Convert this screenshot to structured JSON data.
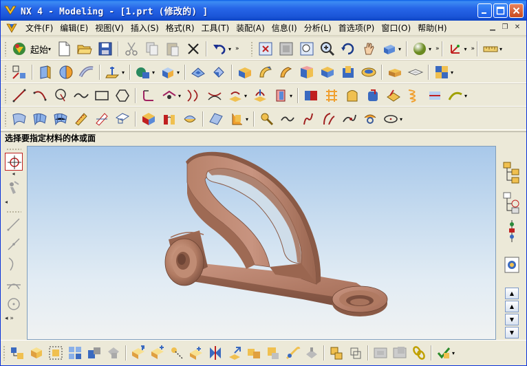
{
  "window": {
    "title": "NX 4 - Modeling - [1.prt  (修改的) ]",
    "minimize_label": "Minimize",
    "maximize_label": "Maximize",
    "close_label": "Close"
  },
  "menubar": {
    "items": [
      "文件(F)",
      "编辑(E)",
      "视图(V)",
      "插入(S)",
      "格式(R)",
      "工具(T)",
      "装配(A)",
      "信息(I)",
      "分析(L)",
      "首选项(P)",
      "窗口(O)",
      "帮助(H)"
    ]
  },
  "standard_toolbar": {
    "start_label": "起始"
  },
  "prompt": {
    "text": "选择要指定材料的体或面"
  },
  "colors": {
    "title_bar": "#1f5fe0",
    "model_brown": "#b07a62",
    "viewport_top": "#a8c8ea",
    "viewport_bottom": "#f0f2f2",
    "face_ui": "#ece9d8"
  },
  "icons": {
    "standard": [
      "new-file-icon",
      "open-folder-icon",
      "save-icon",
      "cut-icon",
      "copy-icon",
      "paste-icon",
      "delete-icon",
      "undo-icon"
    ],
    "view": [
      "fit-icon",
      "zoom-window-icon",
      "zoom-icon",
      "rotate-icon",
      "pan-icon",
      "render-style-icon",
      "sphere-shading-icon",
      "wcs-icon",
      "measure-icon"
    ],
    "feature": [
      "sketch-icon",
      "extrude-icon",
      "revolve-icon",
      "sweep-icon",
      "datum-icon",
      "block-icon",
      "cylinder-icon",
      "cone-icon",
      "sphere-icon",
      "boolean-icon"
    ],
    "curve": [
      "line-icon",
      "arc-icon",
      "circle-icon",
      "spline-icon",
      "rectangle-icon",
      "polygon-icon",
      "fillet-icon",
      "offset-icon"
    ],
    "surface": [
      "ruled-surface-icon",
      "through-curves-icon",
      "mesh-icon",
      "sweep-surface-icon",
      "section-icon"
    ],
    "bottom": [
      "add-component-icon",
      "new-component-icon",
      "reposition-icon",
      "mate-icon",
      "explode-icon",
      "wave-icon",
      "clone-icon",
      "replace-icon"
    ],
    "right_tabs": [
      "assembly-navigator-icon",
      "part-navigator-icon",
      "constraint-navigator-icon",
      "roles-icon"
    ]
  }
}
